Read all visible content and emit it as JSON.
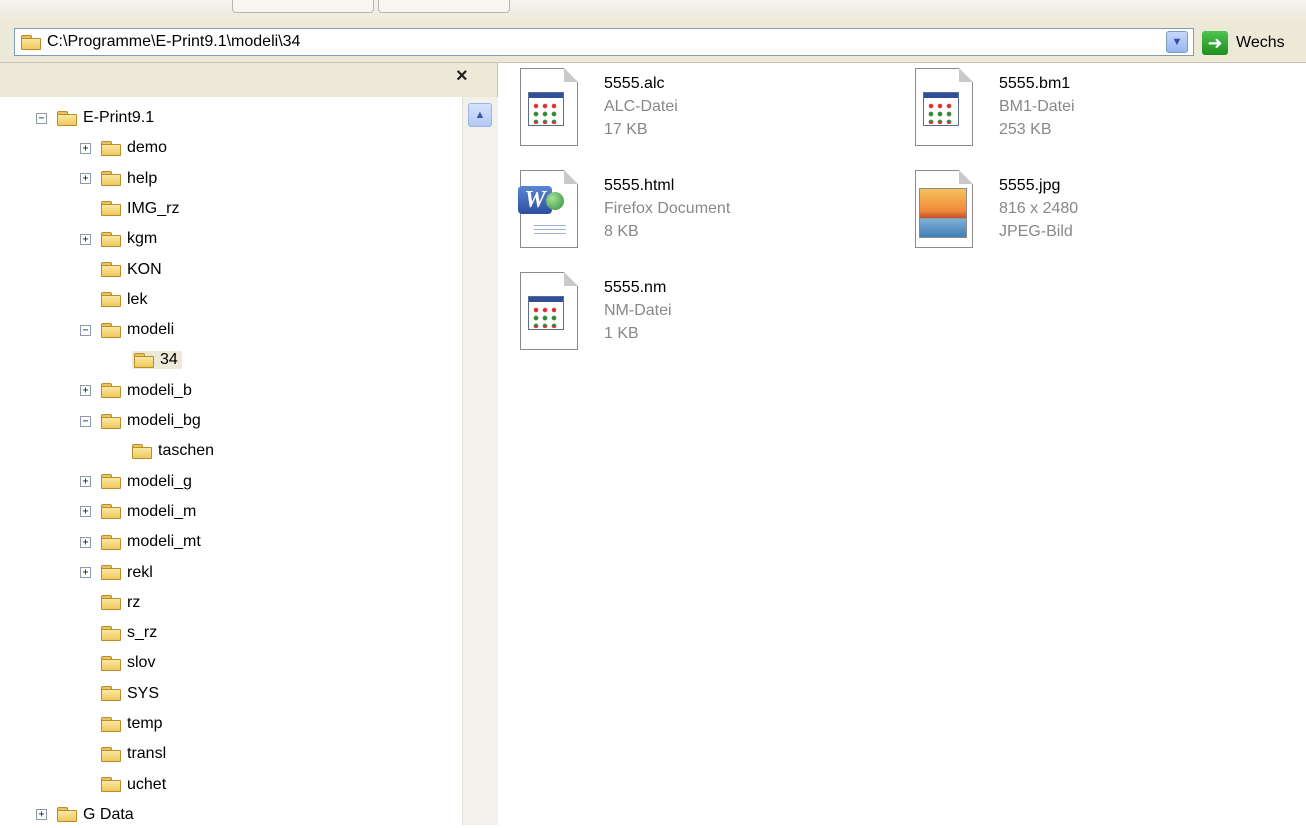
{
  "address": {
    "path": "C:\\Programme\\E-Print9.1\\modeli\\34",
    "go_label": "Wechs"
  },
  "folder_pane": {
    "close_symbol": "×"
  },
  "tree": [
    {
      "label": "E-Print9.1",
      "expander": "−",
      "level": 0
    },
    {
      "label": "demo",
      "expander": "+",
      "level": 1
    },
    {
      "label": "help",
      "expander": "+",
      "level": 1
    },
    {
      "label": "IMG_rz",
      "expander": "",
      "level": 1
    },
    {
      "label": "kgm",
      "expander": "+",
      "level": 1
    },
    {
      "label": "KON",
      "expander": "",
      "level": 1
    },
    {
      "label": "lek",
      "expander": "",
      "level": 1
    },
    {
      "label": "modeli",
      "expander": "−",
      "level": 1
    },
    {
      "label": "34",
      "expander": "",
      "level": 2,
      "selected": true
    },
    {
      "label": "modeli_b",
      "expander": "+",
      "level": 1
    },
    {
      "label": "modeli_bg",
      "expander": "−",
      "level": 1
    },
    {
      "label": "taschen",
      "expander": "",
      "level": 2
    },
    {
      "label": "modeli_g",
      "expander": "+",
      "level": 1
    },
    {
      "label": "modeli_m",
      "expander": "+",
      "level": 1
    },
    {
      "label": "modeli_mt",
      "expander": "+",
      "level": 1
    },
    {
      "label": "rekl",
      "expander": "+",
      "level": 1
    },
    {
      "label": "rz",
      "expander": "",
      "level": 1
    },
    {
      "label": "s_rz",
      "expander": "",
      "level": 1
    },
    {
      "label": "slov",
      "expander": "",
      "level": 1
    },
    {
      "label": "SYS",
      "expander": "",
      "level": 1
    },
    {
      "label": "temp",
      "expander": "",
      "level": 1
    },
    {
      "label": "transl",
      "expander": "",
      "level": 1
    },
    {
      "label": "uchet",
      "expander": "",
      "level": 1
    },
    {
      "label": "G Data",
      "expander": "+",
      "level": 0
    }
  ],
  "files": [
    {
      "name": "5555.alc",
      "type": "ALC-Datei",
      "size": "17 KB",
      "icon": "app-file-icon"
    },
    {
      "name": "5555.bm1",
      "type": "BM1-Datei",
      "size": "253 KB",
      "icon": "app-file-icon"
    },
    {
      "name": "5555.html",
      "type": "Firefox Document",
      "size": "8 KB",
      "icon": "word-html-icon"
    },
    {
      "name": "5555.jpg",
      "type": "816 x 2480",
      "size": "JPEG-Bild",
      "icon": "jpeg-image-icon"
    },
    {
      "name": "5555.nm",
      "type": "NM-Datei",
      "size": "1 KB",
      "icon": "app-file-icon"
    }
  ]
}
